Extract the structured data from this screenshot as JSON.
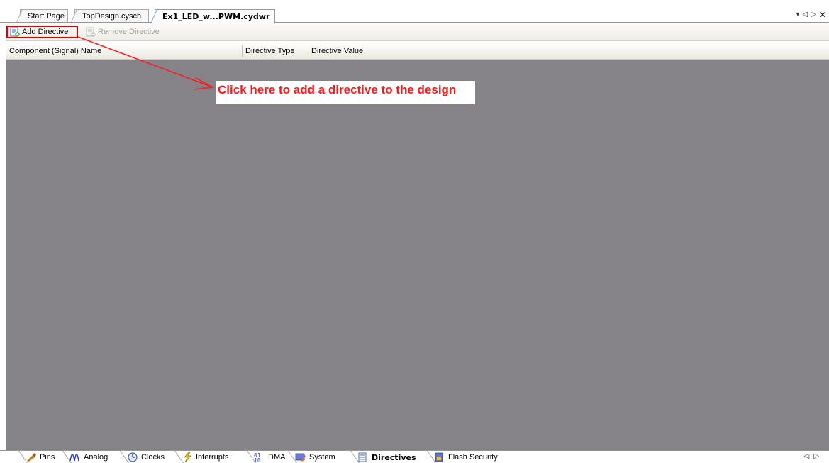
{
  "document_tabs": [
    {
      "label": "Start Page"
    },
    {
      "label": "TopDesign.cysch"
    },
    {
      "label": "Ex1_LED_w...PWM.cydwr",
      "active": true
    }
  ],
  "window_controls": {
    "dropdown": "▾",
    "prev": "◁",
    "next": "▷",
    "close": "✕"
  },
  "toolbar": {
    "add_label": "Add Directive",
    "remove_label": "Remove Directive"
  },
  "columns": {
    "name": "Component (Signal) Name",
    "type": "Directive Type",
    "value": "Directive Value"
  },
  "annotation": {
    "text": "Click here to add a directive to the design",
    "color": "#ff1a1a"
  },
  "bottom_tabs": [
    {
      "label": "Pins",
      "icon": "pins-icon"
    },
    {
      "label": "Analog",
      "icon": "analog-icon"
    },
    {
      "label": "Clocks",
      "icon": "clock-icon"
    },
    {
      "label": "Interrupts",
      "icon": "interrupt-icon"
    },
    {
      "label": "DMA",
      "icon": "dma-icon"
    },
    {
      "label": "System",
      "icon": "system-icon"
    },
    {
      "label": "Directives",
      "icon": "directives-icon",
      "active": true
    },
    {
      "label": "Flash Security",
      "icon": "flash-security-icon"
    }
  ],
  "bottom_nav": {
    "prev": "◁",
    "next": "▷"
  },
  "colors": {
    "content_bg": "#858387",
    "highlight_border": "#e00000",
    "tab_accent": "#7a96df"
  }
}
